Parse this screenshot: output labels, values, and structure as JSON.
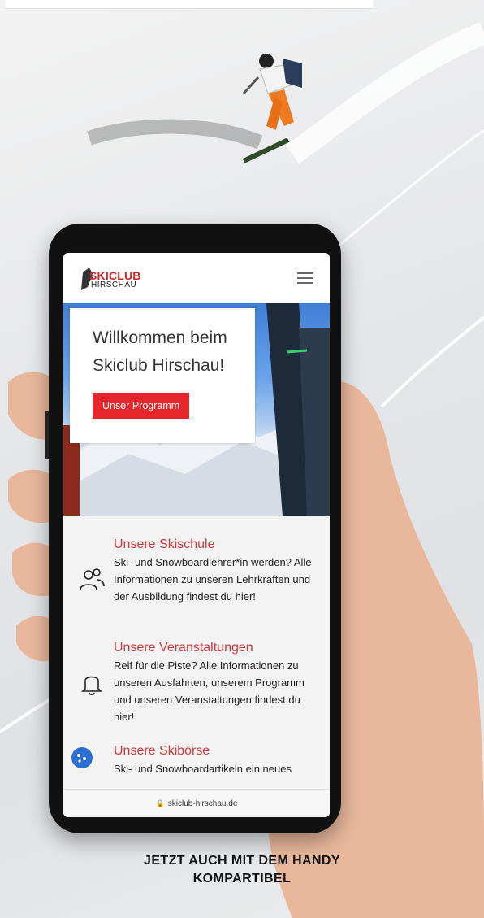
{
  "site": {
    "logo_line1": "SKICLUB",
    "logo_line2": "HIRSCHAU",
    "menu_icon": "hamburger-menu-icon"
  },
  "hero": {
    "title": "Willkommen beim Skiclub Hirschau!",
    "button_label": "Unser Programm"
  },
  "features": [
    {
      "icon": "users-icon",
      "title": "Unsere Skischule",
      "text": "Ski- und Snowboardlehrer*in werden? Alle Informationen zu unseren Lehrkräften und der Ausbildung findest du hier!"
    },
    {
      "icon": "bell-icon",
      "title": "Unsere Veranstaltungen",
      "text": "Reif für die Piste? Alle Informationen zu unseren Ausfahrten, unserem Programm und unseren Veranstaltungen findest du hier!"
    },
    {
      "icon": "cookie-icon",
      "title": "Unsere Skibörse",
      "text": "Ski- und Snowboardartikeln ein neues"
    }
  ],
  "browser": {
    "url": "skiclub-hirschau.de",
    "lock_icon": "lock-icon"
  },
  "caption": {
    "line1": "JETZT AUCH MIT DEM HANDY",
    "line2": "KOMPARTIBEL"
  },
  "colors": {
    "accent_red": "#e5262a",
    "title_red": "#d0393c",
    "phone_black": "#111111"
  }
}
